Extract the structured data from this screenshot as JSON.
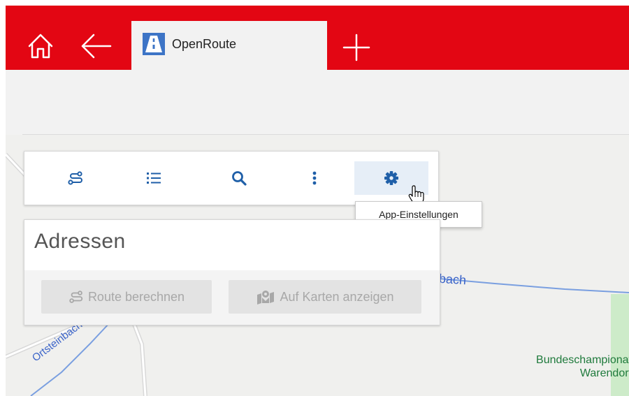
{
  "app": {
    "tab_title": "OpenRoute",
    "brand_color": "#e30613",
    "icons": {
      "home": "home-icon",
      "back": "arrow-left-icon",
      "new_tab": "plus-icon",
      "tab": "openroute-app-icon"
    }
  },
  "toolbar": {
    "accent_color": "#1f5fa8",
    "buttons": [
      {
        "icon": "route-icon"
      },
      {
        "icon": "list-icon"
      },
      {
        "icon": "search-icon"
      },
      {
        "icon": "more-vertical-icon"
      },
      {
        "icon": "gear-icon",
        "hovered": true
      }
    ],
    "tooltip": "App-Einstellungen"
  },
  "panel": {
    "title": "Adressen",
    "buttons": [
      {
        "label": "Route berechnen",
        "icon": "route-icon"
      },
      {
        "label": "Auf Karten anzeigen",
        "icon": "map-marker-icon"
      }
    ]
  },
  "map": {
    "labels": {
      "creek_a": "bach",
      "creek_b": "Ortsteinbach",
      "poi_line1": "Bundeschampionat",
      "poi_line2": "Warendorf"
    }
  }
}
